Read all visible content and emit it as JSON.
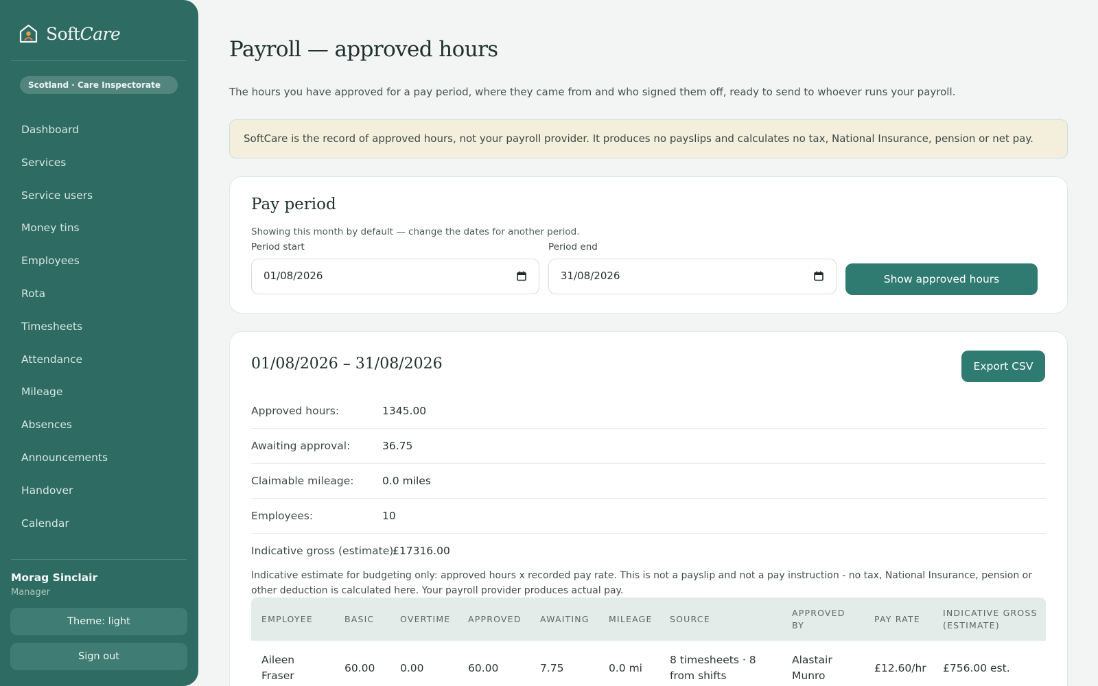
{
  "brand": {
    "name_plain": "Soft",
    "name_italic": "Care"
  },
  "region": "Scotland · Care Inspectorate",
  "nav": [
    "Dashboard",
    "Services",
    "Service users",
    "Money tins",
    "Employees",
    "Rota",
    "Timesheets",
    "Attendance",
    "Mileage",
    "Absences",
    "Announcements",
    "Handover",
    "Calendar"
  ],
  "user": {
    "name": "Morag Sinclair",
    "role": "Manager"
  },
  "theme_button": "Theme: light",
  "signout_button": "Sign out",
  "page": {
    "title": "Payroll — approved hours",
    "subtitle": "The hours you have approved for a pay period, where they came from and who signed them off, ready to send to whoever runs your payroll.",
    "notice": "SoftCare is the record of approved hours, not your payroll provider. It produces no payslips and calculates no tax, National Insurance, pension or net pay."
  },
  "period_card": {
    "title": "Pay period",
    "hint": "Showing this month by default — change the dates for another period.",
    "start_label": "Period start",
    "start_value": "01/08/2026",
    "end_label": "Period end",
    "end_value": "31/08/2026",
    "submit": "Show approved hours"
  },
  "summary_card": {
    "title": "01/08/2026 – 31/08/2026",
    "export": "Export CSV",
    "stats": [
      {
        "label": "Approved hours:",
        "value": "1345.00"
      },
      {
        "label": "Awaiting approval:",
        "value": "36.75"
      },
      {
        "label": "Claimable mileage:",
        "value": "0.0 miles"
      },
      {
        "label": "Employees:",
        "value": "10"
      }
    ],
    "gross_label": "Indicative gross (estimate):",
    "gross_value": "£17316.00",
    "note": "Indicative estimate for budgeting only: approved hours x recorded pay rate. This is not a payslip and not a pay instruction - no tax, National Insurance, pension or other deduction is calculated here. Your payroll provider produces actual pay."
  },
  "table": {
    "headers": [
      "EMPLOYEE",
      "BASIC",
      "OVERTIME",
      "APPROVED",
      "AWAITING",
      "MILEAGE",
      "SOURCE",
      "APPROVED BY",
      "PAY RATE",
      "INDICATIVE GROSS (ESTIMATE)"
    ],
    "rows": [
      [
        "Aileen Fraser",
        "60.00",
        "0.00",
        "60.00",
        "7.75",
        "0.0 mi",
        "8 timesheets · 8 from shifts",
        "Alastair Munro",
        "£12.60/hr",
        "£756.00 est."
      ]
    ]
  }
}
